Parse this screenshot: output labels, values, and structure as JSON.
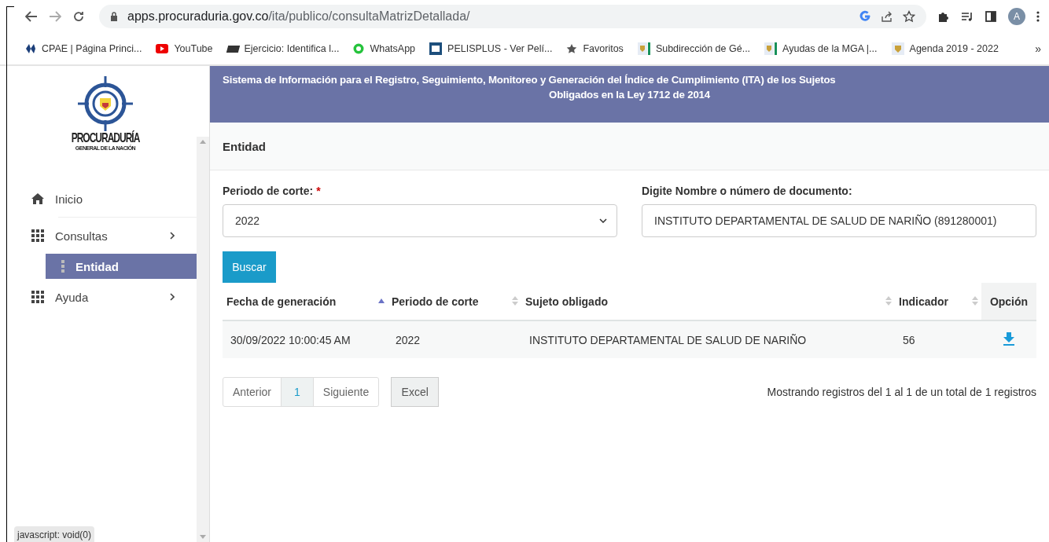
{
  "browser": {
    "url_host": "apps.procuraduria.gov.co",
    "url_path": "/ita/publico/consultaMatrizDetallada/",
    "profile_initial": "A",
    "bookmarks": [
      {
        "kind": "diamond",
        "label": "CPAE | Página Princi..."
      },
      {
        "kind": "video",
        "label": "YouTube"
      },
      {
        "kind": "edx",
        "label": "Ejercicio: Identifica l..."
      },
      {
        "kind": "chat",
        "label": "WhatsApp"
      },
      {
        "kind": "film",
        "label": "PELISPLUS - Ver Pelí..."
      },
      {
        "kind": "star",
        "label": "Favoritos"
      },
      {
        "kind": "shield-bar",
        "label": "Subdirección de Gé..."
      },
      {
        "kind": "shield-bar",
        "label": "Ayudas de la MGA |..."
      },
      {
        "kind": "shield",
        "label": "Agenda 2019 - 2022"
      }
    ],
    "more": "»"
  },
  "logo": {
    "line_1": "PROCURADURÍA",
    "line_2": "GENERAL DE LA NACIÓN"
  },
  "nav": [
    {
      "kind": "home",
      "label": "Inicio",
      "expandable": false,
      "selected": false
    },
    {
      "kind": "grid",
      "label": "Consultas",
      "expandable": true,
      "selected": false,
      "children": [
        {
          "label": "Entidad",
          "selected": true
        }
      ]
    },
    {
      "kind": "grid",
      "label": "Ayuda",
      "expandable": true,
      "selected": false
    }
  ],
  "status_tooltip": "javascript: void(0)",
  "header": {
    "title_line_1": "Sistema de Información para el Registro, Seguimiento, Monitoreo y Generación del Índice de Cumplimiento (ITA) de los Sujetos",
    "title_line_2": "Obligados en la Ley 1712 de 2014"
  },
  "section_title": "Entidad",
  "form": {
    "period": {
      "label": "Periodo de corte:",
      "required_mark": "*",
      "value": "2022"
    },
    "search": {
      "label": "Digite Nombre o número de documento:",
      "value": "INSTITUTO DEPARTAMENTAL DE SALUD DE NARIÑO (891280001)"
    },
    "button": "Buscar"
  },
  "table": {
    "columns": [
      {
        "label": "Fecha de generación",
        "sortable": true,
        "sorted": true
      },
      {
        "label": "Periodo de corte",
        "sortable": true,
        "sorted": false
      },
      {
        "label": "Sujeto obligado",
        "sortable": true,
        "sorted": false
      },
      {
        "label": "Indicador",
        "sortable": true,
        "sorted": false
      },
      {
        "label": "Opción",
        "sortable": false
      }
    ],
    "rows": [
      {
        "date": "30/09/2022 10:00:45 AM",
        "period": "2022",
        "subject": "INSTITUTO DEPARTAMENTAL DE SALUD DE NARIÑO",
        "indicator": "56"
      }
    ]
  },
  "pagination": [
    {
      "label": "Anterior",
      "selected": false
    },
    {
      "label": "1",
      "selected": true
    },
    {
      "label": "Siguiente",
      "selected": false
    }
  ],
  "excel": "Excel",
  "summary": "Mostrando registros del 1 al 1 de un total de 1 registros"
}
